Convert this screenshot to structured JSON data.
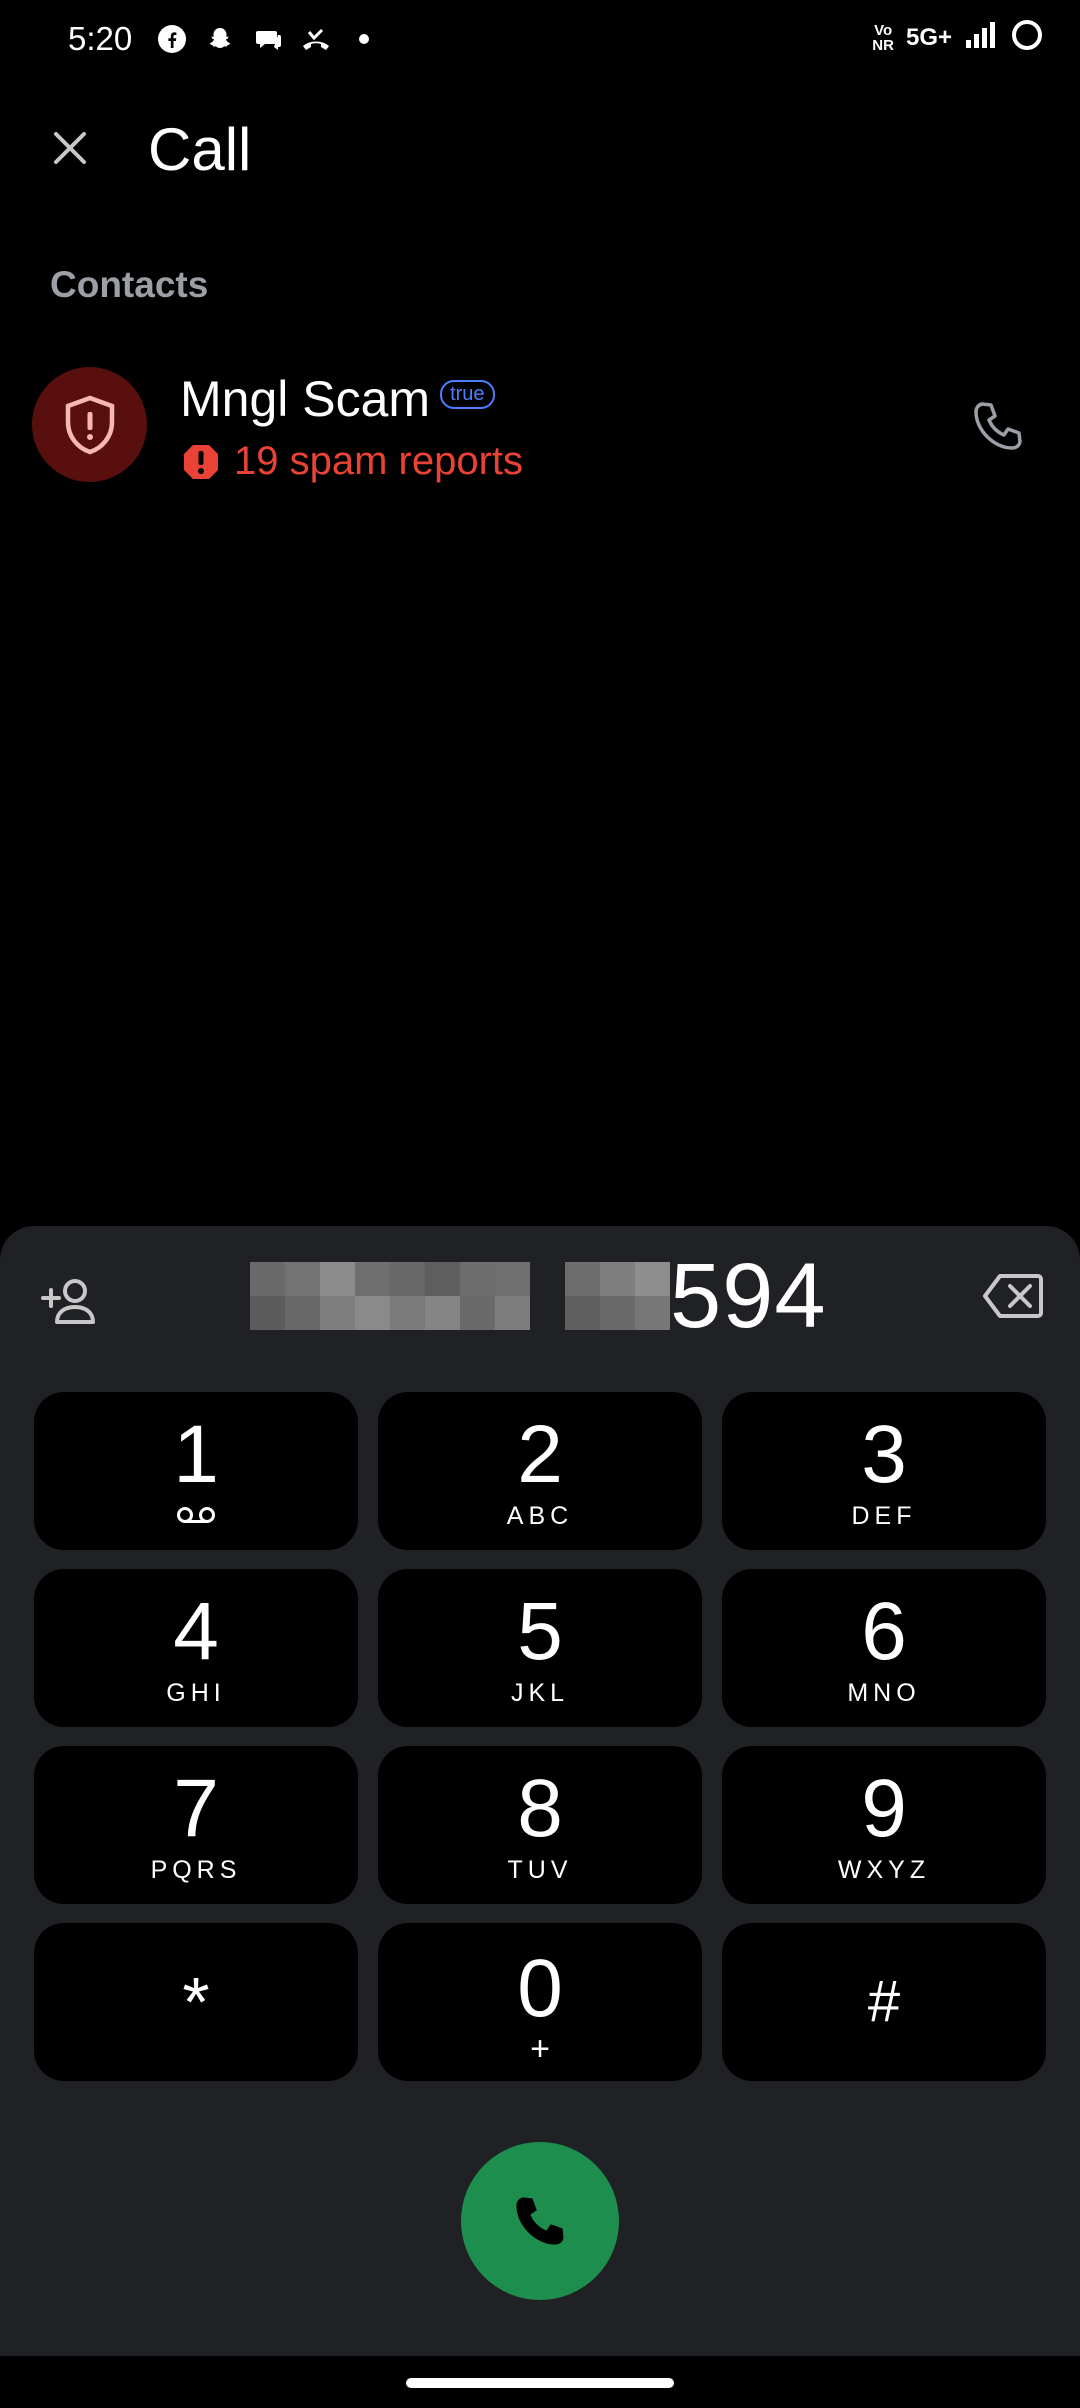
{
  "status_bar": {
    "time": "5:20",
    "left_icons": [
      "facebook-icon",
      "snapchat-icon",
      "chat-icon",
      "missed-call-icon",
      "dot-icon"
    ],
    "vonr_top": "Vo",
    "vonr_bottom": "NR",
    "network": "5G+"
  },
  "header": {
    "title": "Call"
  },
  "contacts": {
    "section_label": "Contacts",
    "items": [
      {
        "name": "Mngl Scam",
        "badge": "true",
        "spam_text": "19 spam reports"
      }
    ]
  },
  "dialer": {
    "number_visible": "594",
    "keys": [
      {
        "digit": "1",
        "letters": ""
      },
      {
        "digit": "2",
        "letters": "ABC"
      },
      {
        "digit": "3",
        "letters": "DEF"
      },
      {
        "digit": "4",
        "letters": "GHI"
      },
      {
        "digit": "5",
        "letters": "JKL"
      },
      {
        "digit": "6",
        "letters": "MNO"
      },
      {
        "digit": "7",
        "letters": "PQRS"
      },
      {
        "digit": "8",
        "letters": "TUV"
      },
      {
        "digit": "9",
        "letters": "WXYZ"
      },
      {
        "digit": "*",
        "letters": ""
      },
      {
        "digit": "0",
        "letters": "+"
      },
      {
        "digit": "#",
        "letters": ""
      }
    ]
  },
  "colors": {
    "spam_red": "#ea4335",
    "avatar_bg": "#5a0f0f",
    "call_green": "#1e8e4e",
    "sheet_bg": "#202124",
    "badge_blue": "#4f7dff"
  }
}
